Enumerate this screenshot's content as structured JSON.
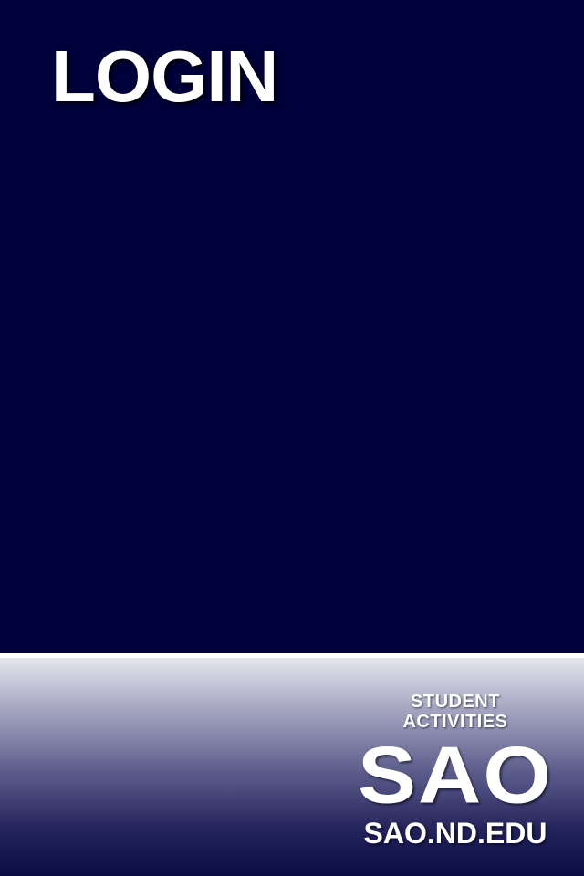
{
  "page": {
    "title": "LOGIN"
  },
  "footer": {
    "logo": {
      "line1": "STUDENT ACTIVITIES",
      "line2": "SAO",
      "line3": "SAO.ND.EDU"
    }
  },
  "colors": {
    "background": "#00003a",
    "title_text": "#ffffff",
    "divider": "#ffffff",
    "footer_gradient_top": "#e6e6ee",
    "footer_gradient_bottom": "#0c0c44"
  }
}
